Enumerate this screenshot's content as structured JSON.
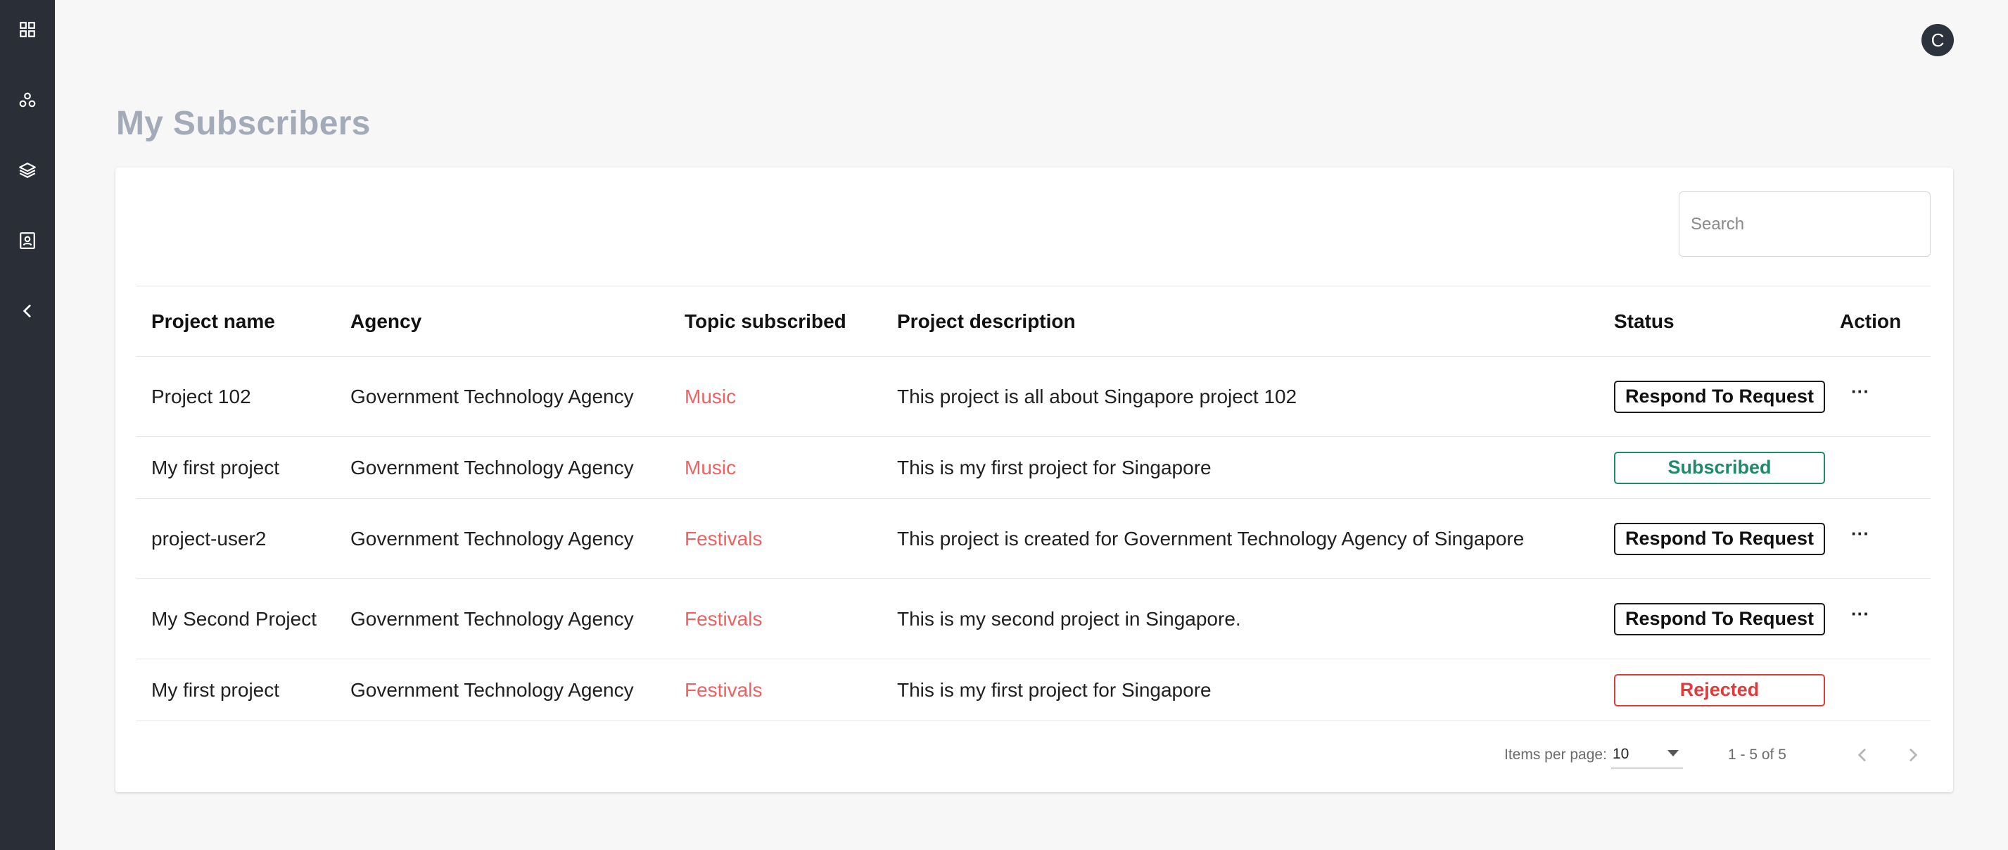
{
  "sidebar": {
    "items": [
      {
        "icon": "grid-icon"
      },
      {
        "icon": "nodes-icon"
      },
      {
        "icon": "layers-icon"
      },
      {
        "icon": "contact-card-icon"
      },
      {
        "icon": "chevron-left-icon"
      }
    ]
  },
  "header": {
    "avatar_initial": "C"
  },
  "page": {
    "title": "My Subscribers"
  },
  "search": {
    "placeholder": "Search",
    "value": ""
  },
  "table": {
    "columns": [
      "Project name",
      "Agency",
      "Topic subscribed",
      "Project description",
      "Status",
      "Action"
    ],
    "rows": [
      {
        "project": "Project 102",
        "agency": "Government Technology Agency",
        "topic": "Music",
        "description": "This project is all about Singapore project 102",
        "status": "Respond To Request",
        "action": "···"
      },
      {
        "project": "My first project",
        "agency": "Government Technology Agency",
        "topic": "Music",
        "description": "This is my first project for Singapore",
        "status": "Subscribed",
        "action": ""
      },
      {
        "project": "project-user2",
        "agency": "Government Technology Agency",
        "topic": "Festivals",
        "description": "This project is created for Government Technology Agency of Singapore",
        "status": "Respond To Request",
        "action": "···"
      },
      {
        "project": "My Second Project",
        "agency": "Government Technology Agency",
        "topic": "Festivals",
        "description": "This is my second project in Singapore.",
        "status": "Respond To Request",
        "action": "···"
      },
      {
        "project": "My first project",
        "agency": "Government Technology Agency",
        "topic": "Festivals",
        "description": "This is my first project for Singapore",
        "status": "Rejected",
        "action": ""
      }
    ]
  },
  "paginator": {
    "items_per_page_label": "Items per page:",
    "items_per_page_value": "10",
    "range_label": "1 - 5 of 5"
  },
  "colors": {
    "sidebar_bg": "#2a2f37",
    "topic": "#ef6161",
    "subscribed": "#1f8a6a",
    "rejected": "#e03b3b",
    "title": "#a3abb8"
  }
}
